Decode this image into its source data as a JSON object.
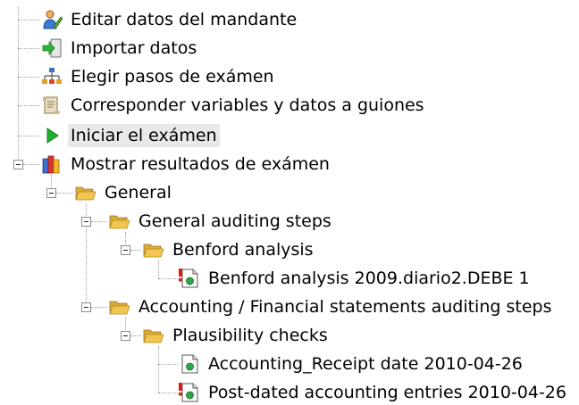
{
  "tree": {
    "top_items": [
      {
        "label": "Editar datos del mandante",
        "icon": "person-edit-icon"
      },
      {
        "label": "Importar datos",
        "icon": "import-data-icon"
      },
      {
        "label": "Elegir pasos de exámen",
        "icon": "hierarchy-icon"
      },
      {
        "label": "Corresponder variables y datos a guiones",
        "icon": "scroll-icon"
      },
      {
        "label": "Iniciar el exámen",
        "icon": "play-icon"
      }
    ],
    "results": {
      "label": "Mostrar resultados de exámen",
      "icon": "books-icon",
      "general": {
        "label": "General",
        "icon": "folder-open-icon",
        "auditing": {
          "label": "General auditing steps",
          "benford": {
            "label": "Benford analysis",
            "items": [
              {
                "label": "Benford analysis 2009.diario2.DEBE 1",
                "icon": "document-warning-icon"
              }
            ]
          }
        },
        "accounting": {
          "label": "Accounting / Financial statements auditing steps",
          "plausibility": {
            "label": "Plausibility checks",
            "items": [
              {
                "label": "Accounting_Receipt date 2010-04-26",
                "icon": "document-icon"
              },
              {
                "label": "Post-dated accounting entries 2010-04-26",
                "icon": "document-warning-icon"
              }
            ]
          }
        }
      }
    }
  },
  "colors": {
    "selection": "#e9e9e9",
    "play": "#1fae2f",
    "folder": "#f3c44e",
    "warning": "#e01515"
  }
}
